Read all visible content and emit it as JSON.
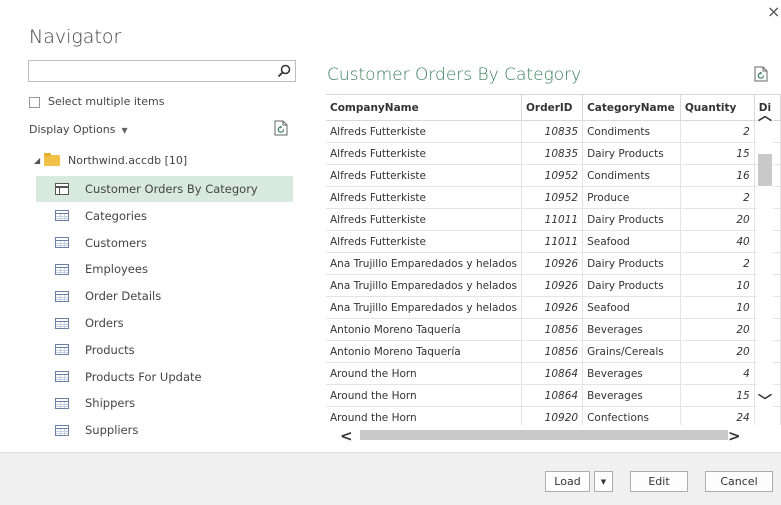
{
  "dialog": {
    "title": "Navigator",
    "close_glyph": "×"
  },
  "left_panel": {
    "search": {
      "value": "",
      "placeholder": ""
    },
    "select_multiple_label": "Select multiple items",
    "display_options_label": "Display Options",
    "tree_root": "Northwind.accdb [10]",
    "items": [
      {
        "label": "Customer Orders By Category",
        "icon": "view-icon",
        "selected": true
      },
      {
        "label": "Categories",
        "icon": "table-icon",
        "selected": false
      },
      {
        "label": "Customers",
        "icon": "table-icon",
        "selected": false
      },
      {
        "label": "Employees",
        "icon": "table-icon",
        "selected": false
      },
      {
        "label": "Order Details",
        "icon": "table-icon",
        "selected": false
      },
      {
        "label": "Orders",
        "icon": "table-icon",
        "selected": false
      },
      {
        "label": "Products",
        "icon": "table-icon",
        "selected": false
      },
      {
        "label": "Products For Update",
        "icon": "table-icon",
        "selected": false
      },
      {
        "label": "Shippers",
        "icon": "table-icon",
        "selected": false
      },
      {
        "label": "Suppliers",
        "icon": "table-icon",
        "selected": false
      }
    ]
  },
  "preview": {
    "title": "Customer Orders By Category",
    "columns": [
      "CompanyName",
      "OrderID",
      "CategoryName",
      "Quantity",
      "Di"
    ],
    "rows": [
      [
        "Alfreds Futterkiste",
        "10835",
        "Condiments",
        "2"
      ],
      [
        "Alfreds Futterkiste",
        "10835",
        "Dairy Products",
        "15"
      ],
      [
        "Alfreds Futterkiste",
        "10952",
        "Condiments",
        "16"
      ],
      [
        "Alfreds Futterkiste",
        "10952",
        "Produce",
        "2"
      ],
      [
        "Alfreds Futterkiste",
        "11011",
        "Dairy Products",
        "20"
      ],
      [
        "Alfreds Futterkiste",
        "11011",
        "Seafood",
        "40"
      ],
      [
        "Ana Trujillo Emparedados y helados",
        "10926",
        "Dairy Products",
        "2"
      ],
      [
        "Ana Trujillo Emparedados y helados",
        "10926",
        "Dairy Products",
        "10"
      ],
      [
        "Ana Trujillo Emparedados y helados",
        "10926",
        "Seafood",
        "10"
      ],
      [
        "Antonio Moreno Taquería",
        "10856",
        "Beverages",
        "20"
      ],
      [
        "Antonio Moreno Taquería",
        "10856",
        "Grains/Cereals",
        "20"
      ],
      [
        "Around the Horn",
        "10864",
        "Beverages",
        "4"
      ],
      [
        "Around the Horn",
        "10864",
        "Beverages",
        "15"
      ],
      [
        "Around the Horn",
        "10920",
        "Confections",
        "24"
      ]
    ]
  },
  "footer": {
    "load_label": "Load",
    "edit_label": "Edit",
    "cancel_label": "Cancel"
  },
  "colors": {
    "accent": "#3b7f5c",
    "selection": "#d8eadd"
  }
}
